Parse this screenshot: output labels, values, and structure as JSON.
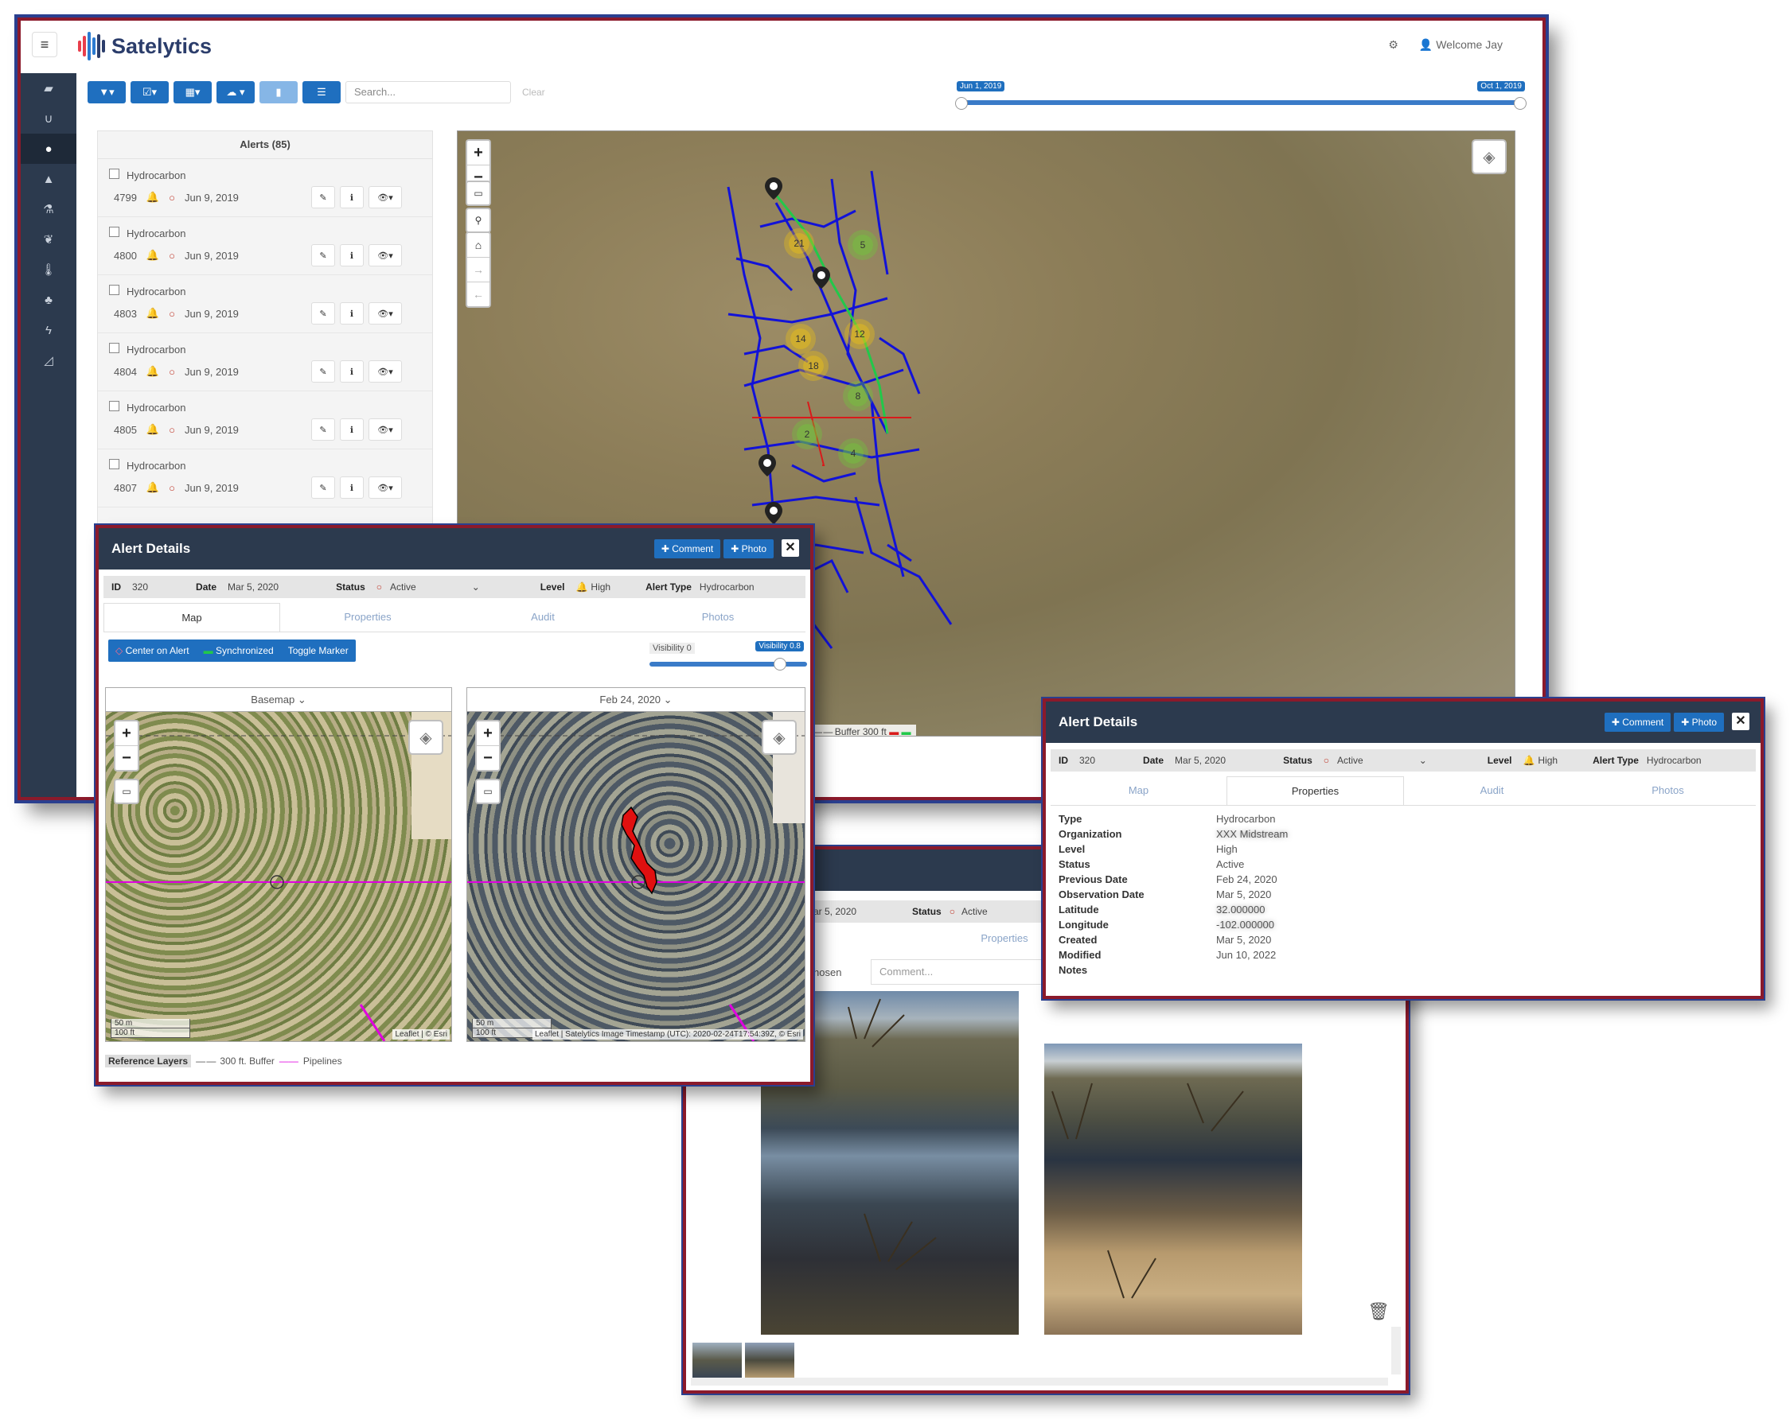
{
  "app": {
    "brand": "Satelytics",
    "welcome": "Welcome Jay",
    "search_placeholder": "Search...",
    "clear_label": "Clear",
    "timeline": {
      "start": "Jun 1, 2019",
      "end": "Oct 1, 2019"
    },
    "sidebar_icons": [
      "folder-icon",
      "magnet-icon",
      "droplet-icon",
      "warning-icon",
      "flask-icon",
      "leaf-icon",
      "thermometer-icon",
      "tree-icon",
      "bolt-icon",
      "area-chart-icon"
    ],
    "brand_colors": {
      "navy": "#2c3a4e",
      "blue": "#1f6fbf",
      "frame": "#8b1a2b"
    }
  },
  "alerts_panel": {
    "title": "Alerts (85)",
    "items": [
      {
        "type": "Hydrocarbon",
        "id": "4799",
        "date": "Jun 9, 2019"
      },
      {
        "type": "Hydrocarbon",
        "id": "4800",
        "date": "Jun 9, 2019"
      },
      {
        "type": "Hydrocarbon",
        "id": "4803",
        "date": "Jun 9, 2019"
      },
      {
        "type": "Hydrocarbon",
        "id": "4804",
        "date": "Jun 9, 2019"
      },
      {
        "type": "Hydrocarbon",
        "id": "4805",
        "date": "Jun 9, 2019"
      },
      {
        "type": "Hydrocarbon",
        "id": "4807",
        "date": "Jun 9, 2019"
      }
    ]
  },
  "main_map": {
    "clusters": [
      "21",
      "5",
      "14",
      "12",
      "18",
      "8",
      "2",
      "4"
    ],
    "legend_buffer": "Buffer 300 ft"
  },
  "detail": {
    "title": "Alert Details",
    "comment_label": "Comment",
    "photo_label": "Photo",
    "id_label": "ID",
    "id": "320",
    "date_label": "Date",
    "date": "Mar 5, 2020",
    "status_label": "Status",
    "status": "Active",
    "level_label": "Level",
    "level": "High",
    "type_label": "Alert Type",
    "type": "Hydrocarbon",
    "tabs": [
      "Map",
      "Properties",
      "Audit",
      "Photos"
    ],
    "options": [
      "Center on Alert",
      "Synchronized",
      "Toggle Marker"
    ],
    "visibility_left": "Visibility 0",
    "visibility_right": "Visibility 0.8",
    "basemap_label": "Basemap",
    "compare_date": "Feb 24, 2020",
    "scale_m": "50 m",
    "scale_ft": "100 ft",
    "attrib_left": "Leaflet | © Esri",
    "attrib_right": "Leaflet | Satelytics Image Timestamp (UTC): 2020-02-24T17:54:39Z, © Esri",
    "ref_layers_label": "Reference Layers",
    "ref_buffer": "300 ft. Buffer",
    "ref_pipelines": "Pipelines"
  },
  "properties": {
    "rows": [
      {
        "k": "Type",
        "v": "Hydrocarbon"
      },
      {
        "k": "Organization",
        "v": "XXX Midstream"
      },
      {
        "k": "Level",
        "v": "High"
      },
      {
        "k": "Status",
        "v": "Active"
      },
      {
        "k": "Previous Date",
        "v": "Feb 24, 2020"
      },
      {
        "k": "Observation Date",
        "v": "Mar 5, 2020"
      },
      {
        "k": "Latitude",
        "v": "32.000000"
      },
      {
        "k": "Longitude",
        "v": "-102.000000"
      },
      {
        "k": "Created",
        "v": "Mar 5, 2020"
      },
      {
        "k": "Modified",
        "v": "Jun 10, 2022"
      },
      {
        "k": "Notes",
        "v": ""
      }
    ]
  },
  "photos_panel": {
    "date_partial": "ar 5, 2020",
    "status_label": "Status",
    "status": "Active",
    "tab_properties": "Properties",
    "file_partial": "hosen",
    "comment_placeholder": "Comment..."
  }
}
